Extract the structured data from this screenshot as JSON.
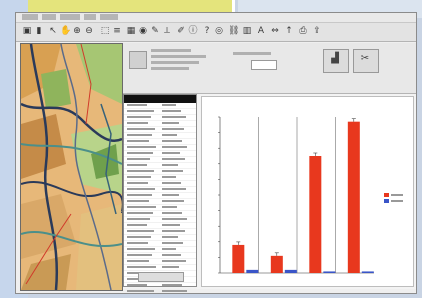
{
  "app": {
    "title": ""
  },
  "infobar": {
    "button_1_label": "",
    "button_2_label": ""
  },
  "chart_data": {
    "type": "bar",
    "title": "",
    "categories": [
      "",
      "",
      "",
      ""
    ],
    "series": [
      {
        "values": [
          18,
          11,
          75,
          97
        ],
        "color": "#e8381e"
      },
      {
        "values": [
          2,
          2,
          1,
          1
        ],
        "color": "#3a55c8"
      }
    ],
    "ylim": [
      0,
      100
    ],
    "legend_position": "right",
    "grid": false
  },
  "colors": {
    "accent_red": "#e8381e",
    "accent_blue": "#3a55c8"
  }
}
